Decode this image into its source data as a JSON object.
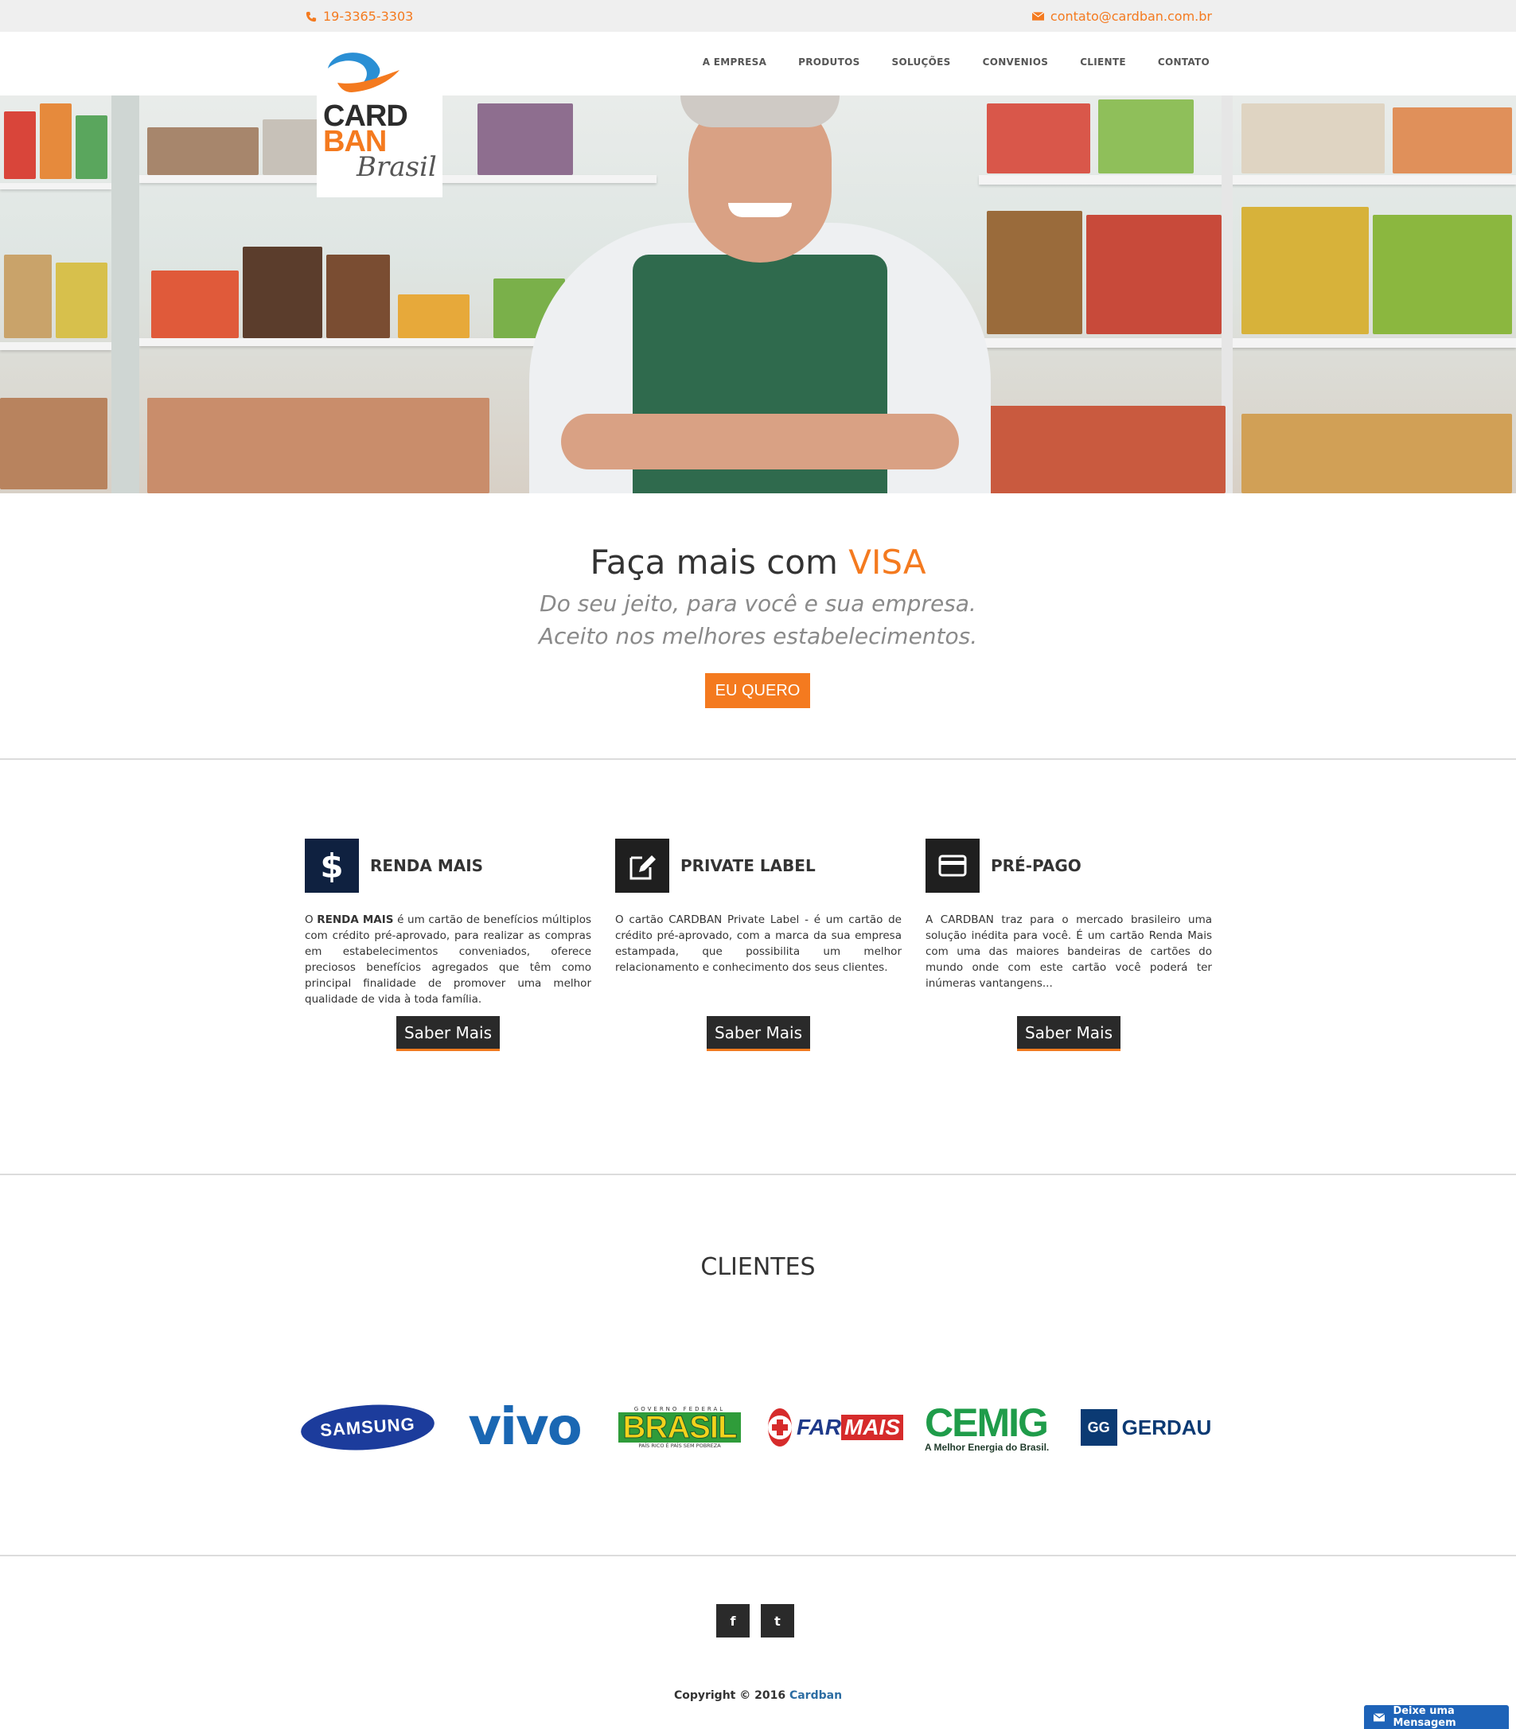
{
  "topbar": {
    "phone": "19-3365-3303",
    "email": "contato@cardban.com.br"
  },
  "logo": {
    "line1": "CARD",
    "line2": "BAN",
    "script": "Brasil"
  },
  "nav": [
    {
      "label": "A EMPRESA"
    },
    {
      "label": "PRODUTOS"
    },
    {
      "label": "SOLUÇÕES"
    },
    {
      "label": "CONVENIOS"
    },
    {
      "label": "CLIENTE"
    },
    {
      "label": "CONTATO"
    }
  ],
  "promo": {
    "title_prefix": "Faça mais com ",
    "title_accent": "VISA",
    "subtitle_1": "Do seu jeito, para você e sua empresa.",
    "subtitle_2": "Aceito nos melhores estabelecimentos.",
    "button": "EU QUERO"
  },
  "features": [
    {
      "title": "RENDA MAIS",
      "text_prefix": "O ",
      "text_bold": "RENDA MAIS",
      "text_rest": " é um cartão de benefícios múltiplos com crédito pré-aprovado, para realizar as compras em estabelecimentos conveniados, oferece preciosos benefícios agregados que têm como principal finalidade de promover uma melhor qualidade de vida à toda família.",
      "button": "Saber Mais",
      "icon": "dollar-icon"
    },
    {
      "title": "PRIVATE LABEL",
      "text": "O cartão CARDBAN Private Label - é um cartão de crédito pré-aprovado, com a marca da sua empresa estampada, que possibilita um melhor relacionamento e conhecimento dos seus clientes.",
      "button": "Saber Mais",
      "icon": "pencil-note-icon"
    },
    {
      "title": "PRÉ-PAGO",
      "text": "A CARDBAN traz para o mercado brasileiro uma solução inédita para você. É um cartão Renda Mais com uma das maiores bandeiras de cartões do mundo onde com este cartão você poderá ter inúmeras vantangens...",
      "button": "Saber Mais",
      "icon": "credit-card-icon"
    }
  ],
  "clients": {
    "title": "CLIENTES",
    "logos": [
      {
        "name": "SAMSUNG"
      },
      {
        "name": "vivo"
      },
      {
        "name": "BRASIL",
        "top": "GOVERNO FEDERAL",
        "bottom": "PAÍS RICO É PAÍS SEM POBREZA"
      },
      {
        "name_1": "FAR",
        "name_2": "MAIS"
      },
      {
        "name": "CEMIG",
        "tagline": "A Melhor Energia do Brasil."
      },
      {
        "name": "GERDAU",
        "mark": "GG"
      }
    ]
  },
  "footer": {
    "social": [
      {
        "label": "f",
        "icon": "facebook-icon"
      },
      {
        "label": "t",
        "icon": "twitter-icon"
      }
    ],
    "copyright": "Copyright © 2016 ",
    "brand": "Cardban",
    "message_button": "Deixe uma Mensagem"
  },
  "colors": {
    "accent": "#f47a1f",
    "dark": "#2a2a2a",
    "brand_blue": "#2d6da3",
    "chat_blue": "#1e63b8"
  }
}
